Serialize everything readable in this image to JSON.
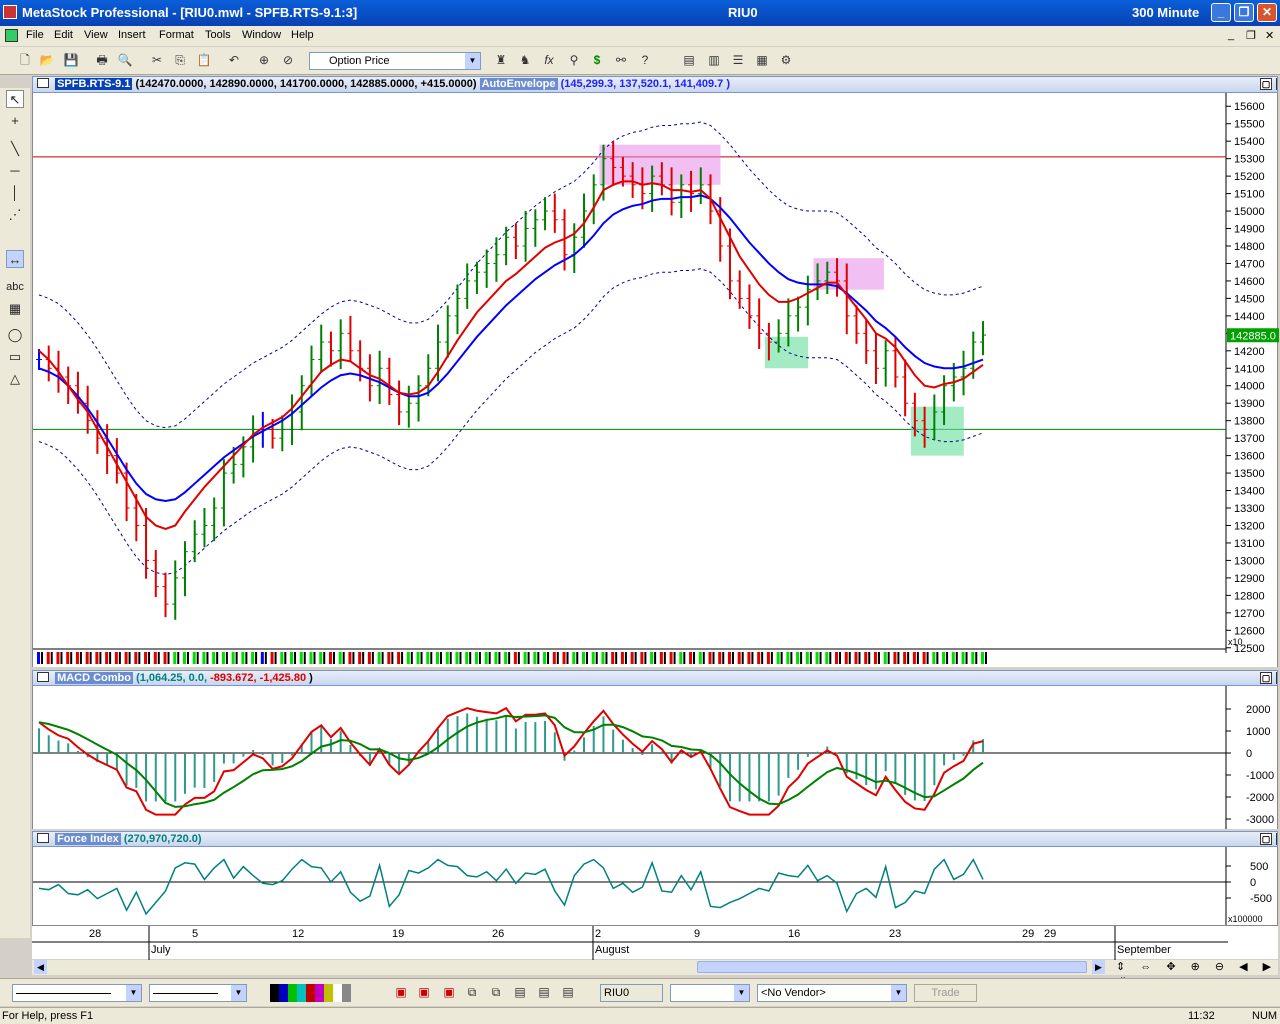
{
  "window": {
    "app_title": "MetaStock Professional - [RIU0.mwl - SPFB.RTS-9.1:3]",
    "center_title": "RIU0",
    "interval": "300 Minute"
  },
  "menu": [
    "File",
    "Edit",
    "View",
    "Insert",
    "Format",
    "Tools",
    "Window",
    "Help"
  ],
  "toolbar": {
    "price_field": "Option Price"
  },
  "price_pane": {
    "security": "SPFB.RTS-9.1",
    "ohlc": "(142470.0000, 142890.0000, 141700.0000, 142885.0000, +415.0000)",
    "indicator": "AutoEnvelope",
    "indicator_values": "(145,299.3, 137,520.1, 141,409.7 )",
    "last_price": "142885.0",
    "y_ticks": [
      "15600",
      "15500",
      "15400",
      "15300",
      "15200",
      "15100",
      "15000",
      "14900",
      "14800",
      "14700",
      "14600",
      "14500",
      "14400",
      "14300",
      "14200",
      "14100",
      "14000",
      "13900",
      "13800",
      "13700",
      "13600",
      "13500",
      "13400",
      "13300",
      "13200",
      "13100",
      "13000",
      "12900",
      "12800",
      "12700",
      "12600",
      "12500"
    ],
    "y_multiplier": "x10"
  },
  "macd_pane": {
    "name": "MACD Combo",
    "values": "(1,064.25, 0.0, ",
    "values_red": "-893.672, -1,425.80",
    "values_close": " )",
    "y_ticks": [
      "2000",
      "1000",
      "0",
      "-1000",
      "-2000",
      "-3000"
    ]
  },
  "force_pane": {
    "name": "Force Index",
    "values": "(270,970,720.0)",
    "y_ticks": [
      "500",
      "0",
      "-500"
    ],
    "y_multiplier": "x100000"
  },
  "time_axis": {
    "days": [
      "28",
      "5",
      "12",
      "19",
      "26",
      "2",
      "9",
      "16",
      "23",
      "29",
      "29"
    ],
    "months": [
      "July",
      "August",
      "September"
    ]
  },
  "bottom": {
    "symbol": "RIU0",
    "vendor": "<No Vendor>",
    "trade": "Trade"
  },
  "status": {
    "help": "For Help, press F1",
    "time": "11:32",
    "num": "NUM"
  },
  "chart_data": {
    "type": "bar",
    "title": "SPFB.RTS-9.1 RIU0 300 Minute",
    "ylim": [
      12500,
      15650
    ],
    "scale_note": "prices shown x10",
    "close_series": [
      14150,
      14100,
      14050,
      14000,
      13900,
      13800,
      13700,
      13600,
      13500,
      13300,
      13200,
      13000,
      12850,
      12750,
      12900,
      13050,
      13150,
      13200,
      13300,
      13500,
      13550,
      13650,
      13750,
      13750,
      13700,
      13750,
      13850,
      14000,
      14150,
      14250,
      14200,
      14300,
      14200,
      14100,
      14000,
      14100,
      13950,
      13850,
      13900,
      14000,
      14100,
      14250,
      14400,
      14500,
      14600,
      14650,
      14700,
      14750,
      14850,
      14800,
      14900,
      14950,
      15000,
      14950,
      14750,
      14850,
      15000,
      15150,
      15300,
      15250,
      15200,
      15150,
      15100,
      15200,
      15150,
      15050,
      15150,
      15100,
      15150,
      15000,
      14800,
      14600,
      14500,
      14400,
      14300,
      14250,
      14300,
      14400,
      14450,
      14550,
      14600,
      14650,
      14600,
      14400,
      14300,
      14200,
      14100,
      14200,
      14050,
      13900,
      13800,
      13750,
      13850,
      14000,
      14050,
      14100,
      14250,
      14290
    ],
    "series": [
      {
        "name": "red_ma",
        "values": [
          14200,
          14150,
          14080,
          14000,
          13920,
          13850,
          13750,
          13650,
          13550,
          13450,
          13350,
          13250,
          13200,
          13180,
          13200,
          13280,
          13350,
          13420,
          13480,
          13540,
          13600,
          13660,
          13720,
          13760,
          13790,
          13820,
          13870,
          13940,
          14010,
          14080,
          14120,
          14150,
          14140,
          14100,
          14060,
          14040,
          14000,
          13960,
          13950,
          13960,
          14000,
          14080,
          14170,
          14260,
          14340,
          14420,
          14480,
          14540,
          14600,
          14640,
          14690,
          14740,
          14790,
          14820,
          14840,
          14870,
          14930,
          15020,
          15120,
          15150,
          15170,
          15170,
          15150,
          15160,
          15150,
          15120,
          15120,
          15110,
          15120,
          15070,
          14960,
          14850,
          14740,
          14660,
          14580,
          14520,
          14480,
          14480,
          14500,
          14530,
          14560,
          14590,
          14590,
          14520,
          14450,
          14380,
          14300,
          14270,
          14220,
          14140,
          14060,
          14000,
          13990,
          14010,
          14020,
          14040,
          14080,
          14120
        ]
      },
      {
        "name": "blue_ma",
        "values": [
          14100,
          14080,
          14050,
          14000,
          13940,
          13870,
          13790,
          13700,
          13610,
          13520,
          13440,
          13380,
          13350,
          13340,
          13350,
          13390,
          13440,
          13490,
          13540,
          13590,
          13630,
          13670,
          13710,
          13740,
          13770,
          13800,
          13840,
          13890,
          13940,
          13990,
          14030,
          14060,
          14070,
          14060,
          14040,
          14020,
          13990,
          13960,
          13940,
          13940,
          13960,
          14010,
          14070,
          14140,
          14210,
          14280,
          14340,
          14400,
          14460,
          14510,
          14560,
          14610,
          14650,
          14690,
          14720,
          14750,
          14800,
          14860,
          14930,
          14980,
          15010,
          15030,
          15040,
          15060,
          15070,
          15070,
          15080,
          15080,
          15090,
          15070,
          15020,
          14960,
          14890,
          14820,
          14760,
          14700,
          14650,
          14610,
          14590,
          14580,
          14580,
          14580,
          14570,
          14530,
          14480,
          14430,
          14370,
          14330,
          14280,
          14220,
          14170,
          14130,
          14110,
          14100,
          14100,
          14110,
          14130,
          14150
        ]
      }
    ]
  }
}
